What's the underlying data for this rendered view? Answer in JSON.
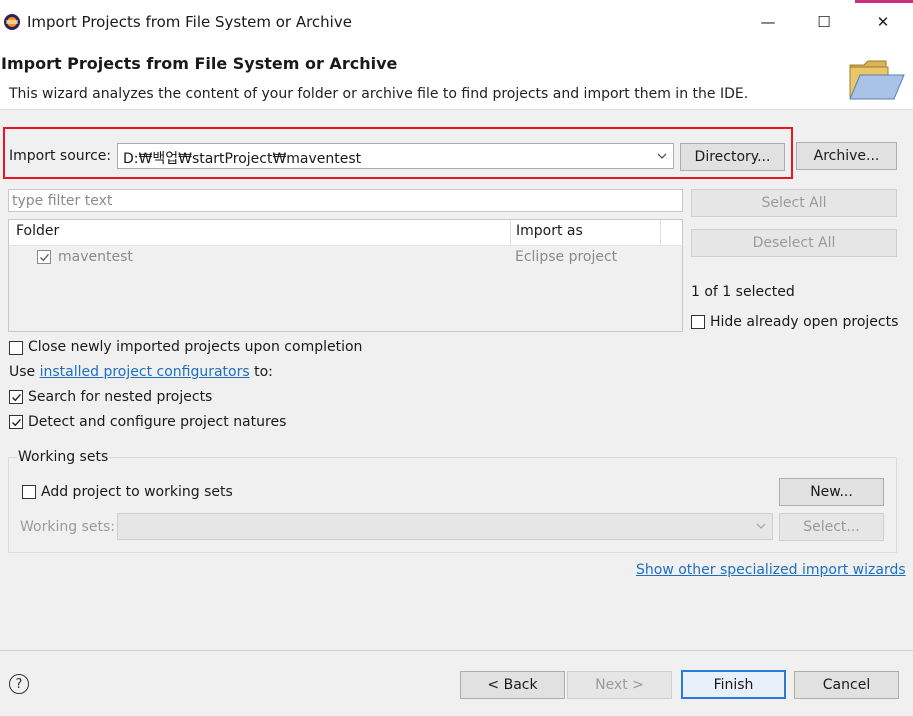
{
  "window": {
    "title": "Import Projects from File System or Archive",
    "minimize_glyph": "—",
    "maximize_glyph": "☐",
    "close_glyph": "✕"
  },
  "banner": {
    "title": "Import Projects from File System or Archive",
    "description": "This wizard analyzes the content of your folder or archive file to find projects and import them in the IDE.",
    "icon": "folder-open-icon"
  },
  "import_source": {
    "label": "Import source:",
    "value": "D:₩백업₩startProject₩maventest",
    "directory_button": "Directory...",
    "archive_button": "Archive..."
  },
  "filter": {
    "placeholder": "type filter text"
  },
  "table": {
    "columns": [
      "Folder",
      "Import as"
    ],
    "rows": [
      {
        "folder": "maventest",
        "import_as": "Eclipse project",
        "checked": true
      }
    ]
  },
  "side": {
    "select_all": "Select All",
    "deselect_all": "Deselect All",
    "selected_count": "1 of 1 selected",
    "hide_open": "Hide already open projects"
  },
  "options": {
    "close_newly": "Close newly imported projects upon completion",
    "use_prefix": "Use",
    "configurators_link": "installed project configurators",
    "use_suffix": "to:",
    "search_nested": "Search for nested projects",
    "detect_natures": "Detect and configure project natures"
  },
  "working_sets": {
    "group_label": "Working sets",
    "add_label": "Add project to working sets",
    "new_button": "New...",
    "sets_label": "Working sets:",
    "select_button": "Select..."
  },
  "specialized_link": "Show other specialized import wizards",
  "footer": {
    "help": "?",
    "back": "< Back",
    "next": "Next >",
    "finish": "Finish",
    "cancel": "Cancel"
  },
  "colors": {
    "highlight": "#e8171f",
    "link": "#1f6fbf",
    "window_bg": "#f0f0f0"
  }
}
